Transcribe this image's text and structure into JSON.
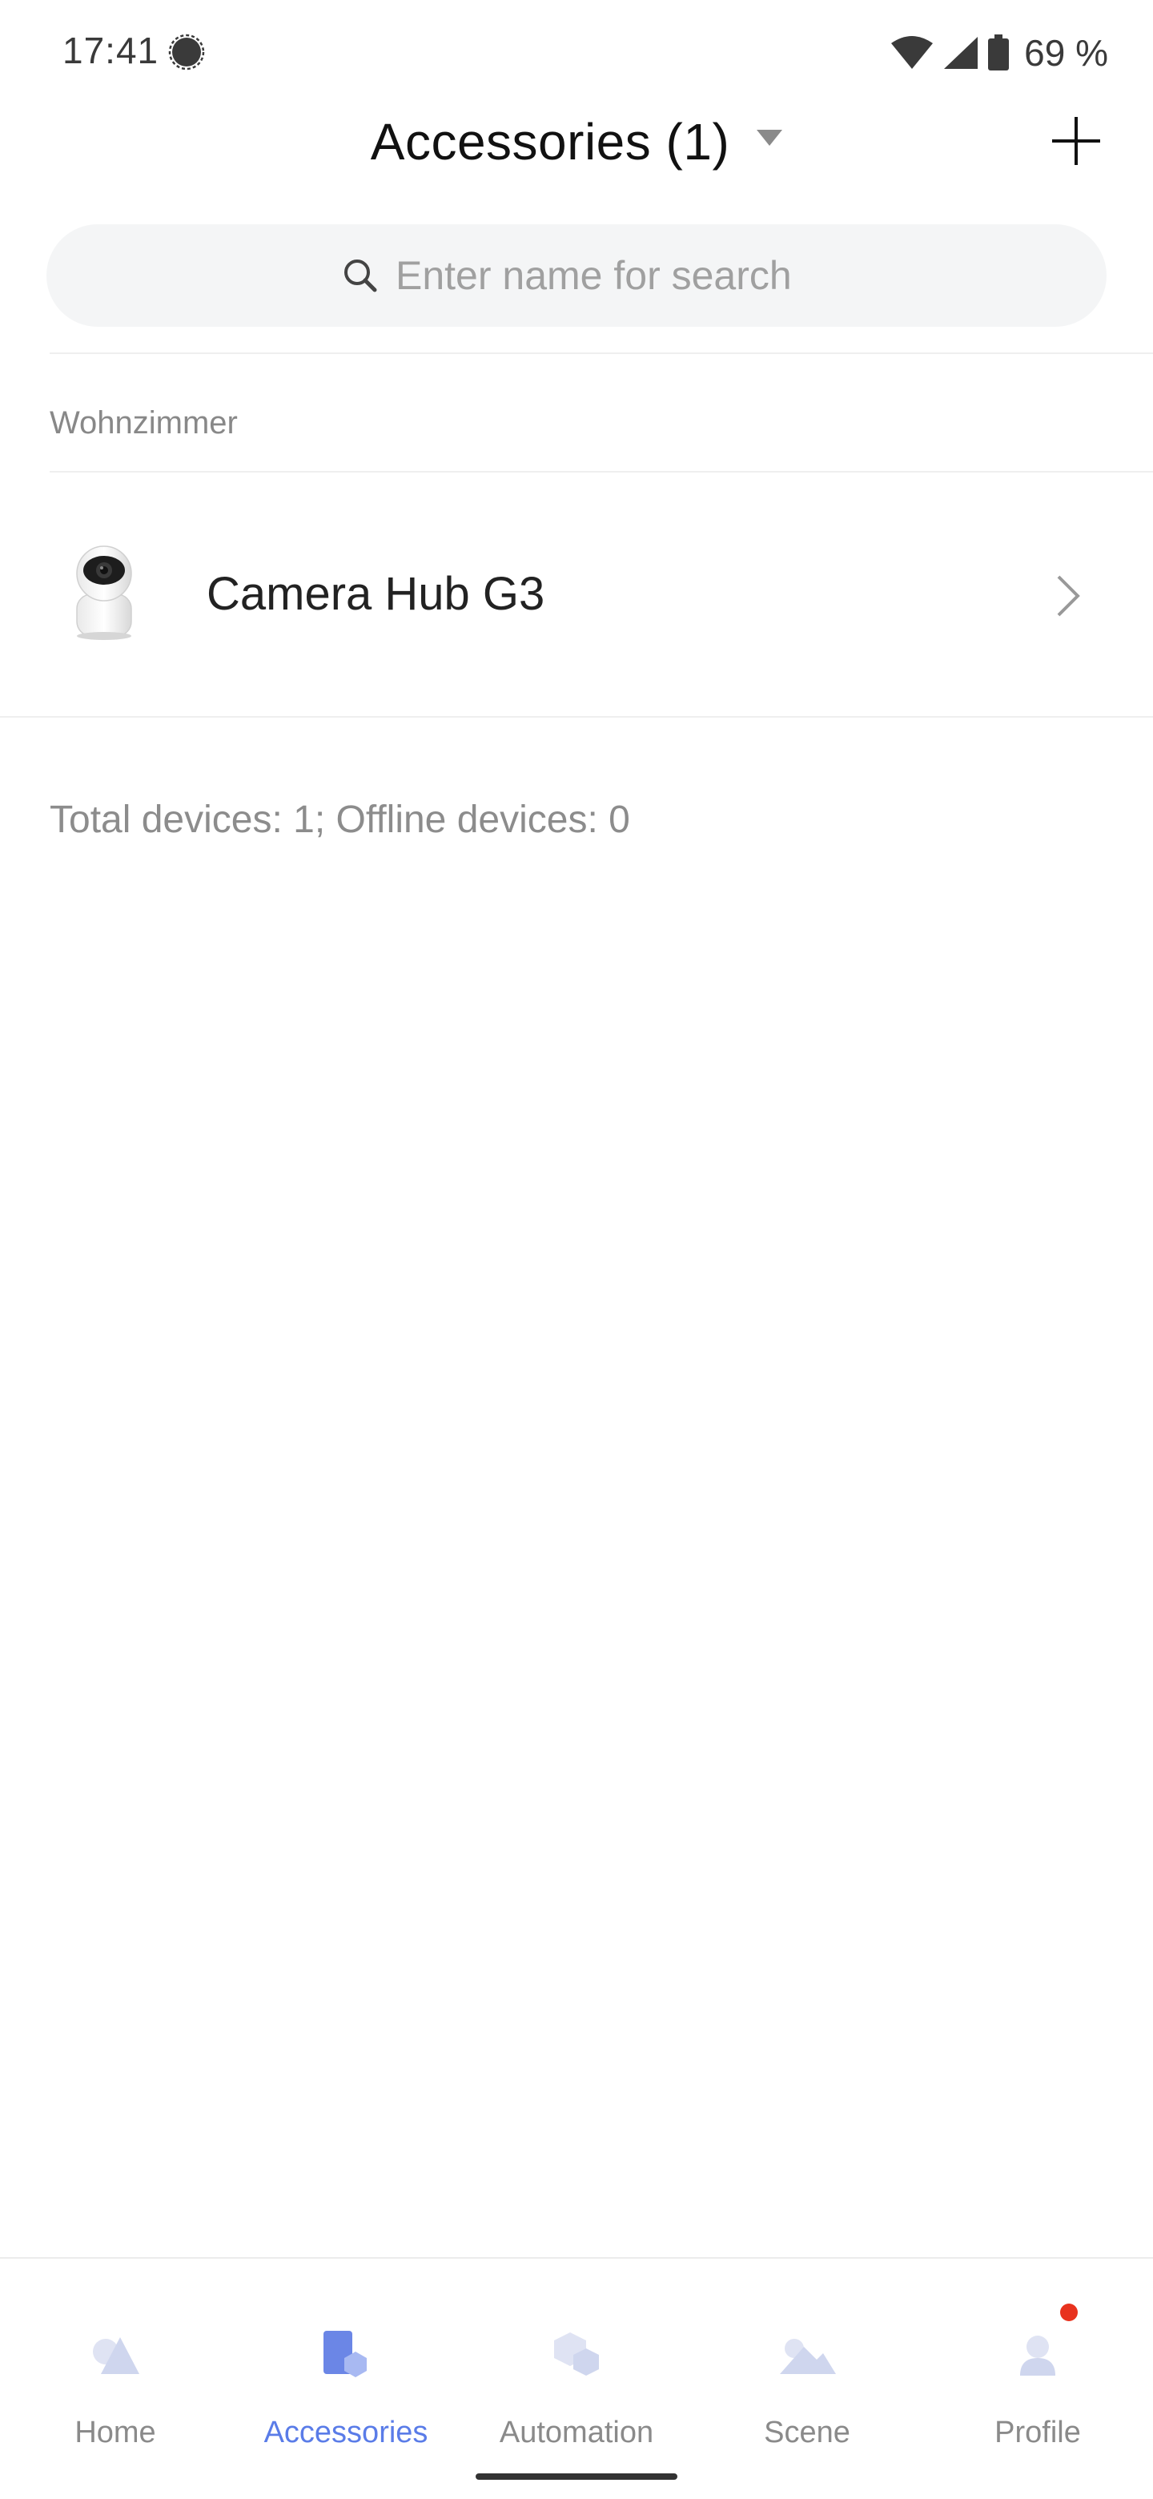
{
  "status_bar": {
    "time": "17:41",
    "battery": "69 %",
    "icons": [
      "signal-app-icon",
      "wifi-icon",
      "cell-signal-icon",
      "battery-icon"
    ]
  },
  "header": {
    "title": "Accessories (1)",
    "dropdown_icon": "caret-down-icon",
    "add_icon": "plus-icon"
  },
  "search": {
    "placeholder": "Enter name for search",
    "icon": "search-icon"
  },
  "rooms": [
    {
      "name": "Wohnzimmer",
      "devices": [
        {
          "name": "Camera Hub G3",
          "icon": "camera-hub-icon"
        }
      ]
    }
  ],
  "summary": "Total devices: 1; Offline devices: 0",
  "bottom_nav": {
    "active": "Accessories",
    "accent_color": "#5a7ce8",
    "items": [
      {
        "label": "Home",
        "icon": "home-icon"
      },
      {
        "label": "Accessories",
        "icon": "accessories-icon"
      },
      {
        "label": "Automation",
        "icon": "automation-icon"
      },
      {
        "label": "Scene",
        "icon": "scene-icon"
      },
      {
        "label": "Profile",
        "icon": "profile-icon",
        "badge": true
      }
    ]
  }
}
